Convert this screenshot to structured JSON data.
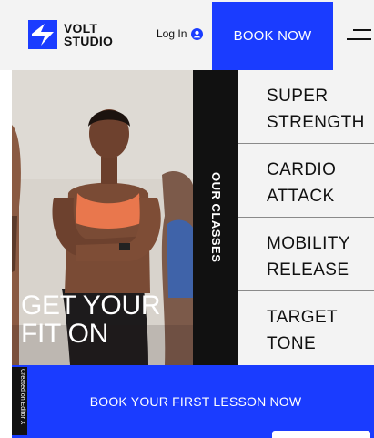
{
  "header": {
    "logo_line1": "VOLT",
    "logo_line2": "STUDIO",
    "login_label": "Log In",
    "book_label": "BOOK NOW"
  },
  "hero": {
    "title_line1": "GET YOUR",
    "title_line2": "FIT ON"
  },
  "classes_tab": {
    "label": "OUR CLASSES"
  },
  "classes": [
    {
      "line1": "SUPER",
      "line2": "STRENGTH"
    },
    {
      "line1": "CARDIO",
      "line2": "ATTACK"
    },
    {
      "line1": "MOBILITY",
      "line2": "RELEASE"
    },
    {
      "line1": "TARGET",
      "line2": "TONE"
    }
  ],
  "cta": {
    "label": "BOOK YOUR FIRST LESSON NOW"
  },
  "badge": {
    "label": "Created on Editor X"
  },
  "colors": {
    "accent": "#1a3cff",
    "dark": "#111111",
    "panel": "#f3f3f3"
  }
}
